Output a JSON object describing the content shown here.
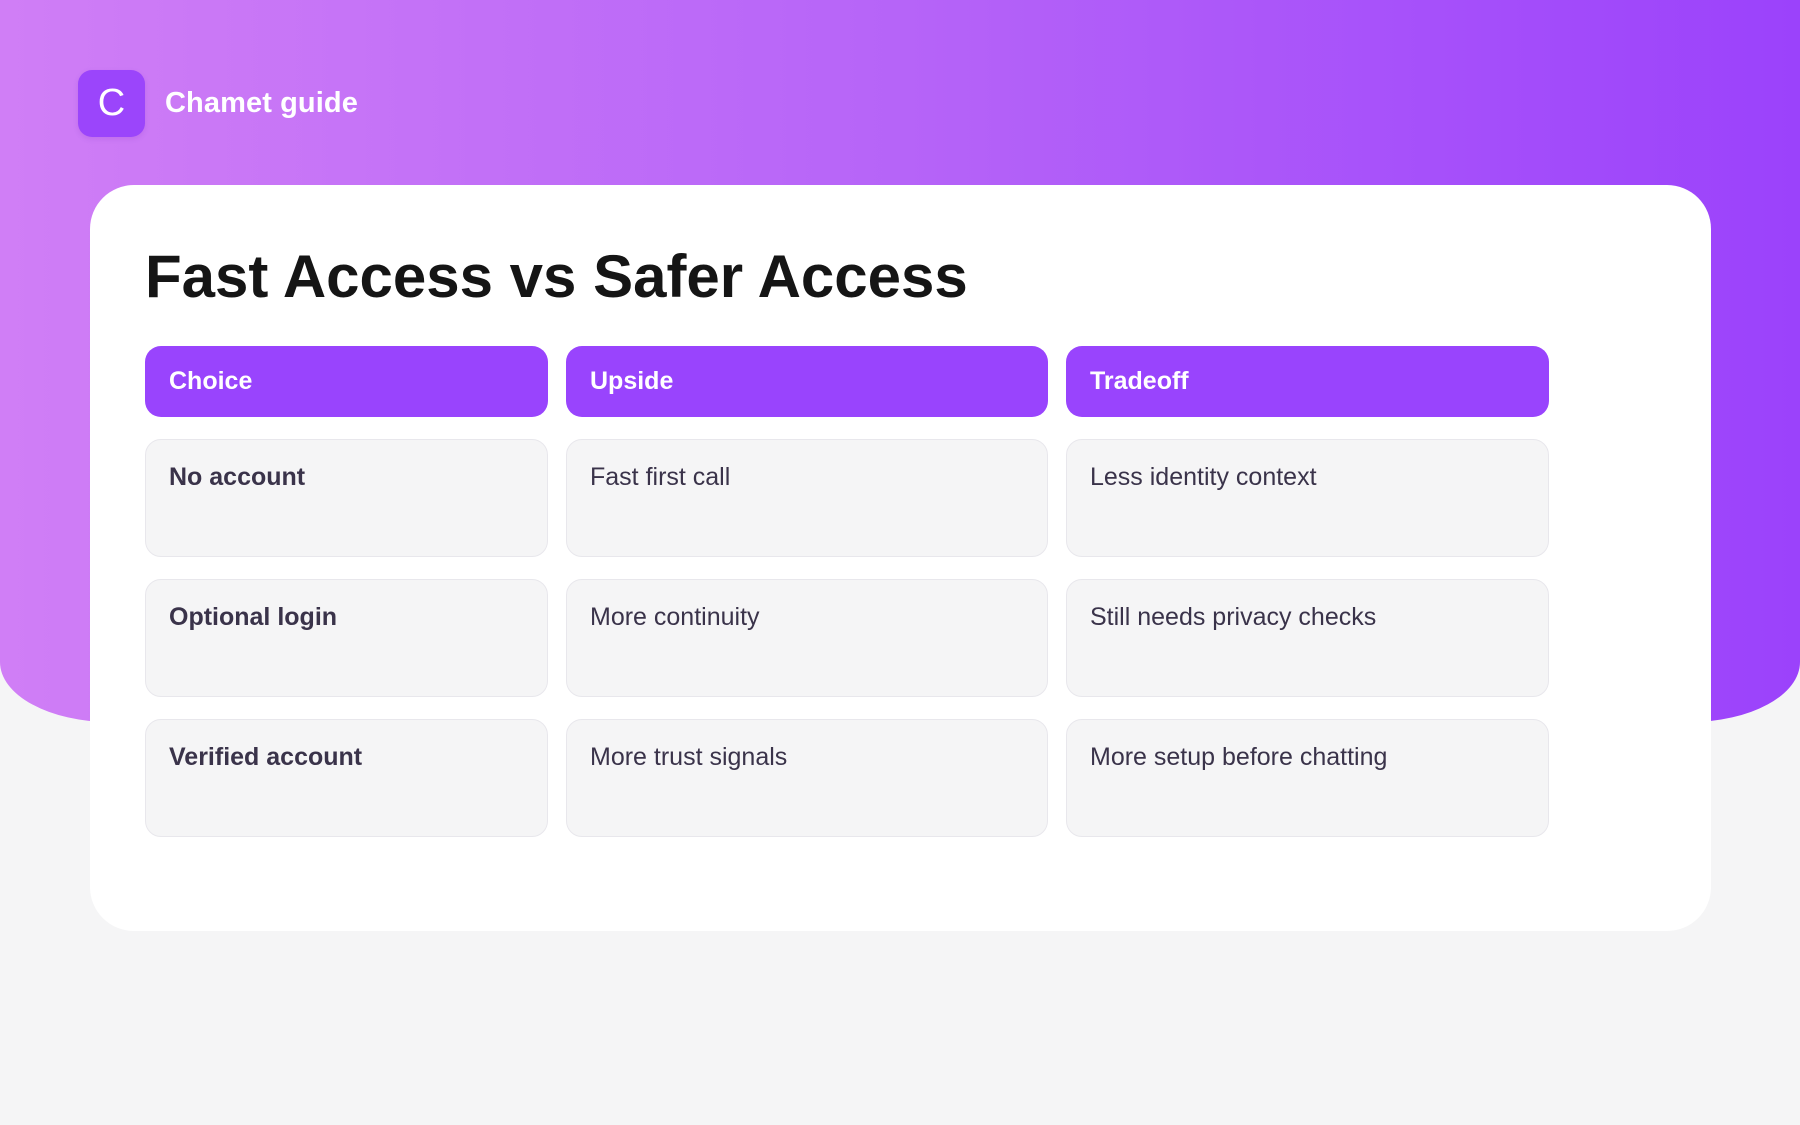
{
  "brand": {
    "logo_letter": "C",
    "name": "Chamet guide"
  },
  "card": {
    "title": "Fast Access vs Safer Access"
  },
  "table": {
    "headers": [
      "Choice",
      "Upside",
      "Tradeoff"
    ],
    "rows": [
      [
        "No account",
        "Fast first call",
        "Less identity context"
      ],
      [
        "Optional login",
        "More continuity",
        "Still needs privacy checks"
      ],
      [
        "Verified account",
        "More trust signals",
        "More setup before chatting"
      ]
    ]
  },
  "colors": {
    "accent": "#9944fd",
    "gradient_start": "#d07ef6",
    "gradient_end": "#9b42fb",
    "background": "#f5f5f6",
    "title_text": "#151515",
    "cell_text": "#3a334a"
  }
}
